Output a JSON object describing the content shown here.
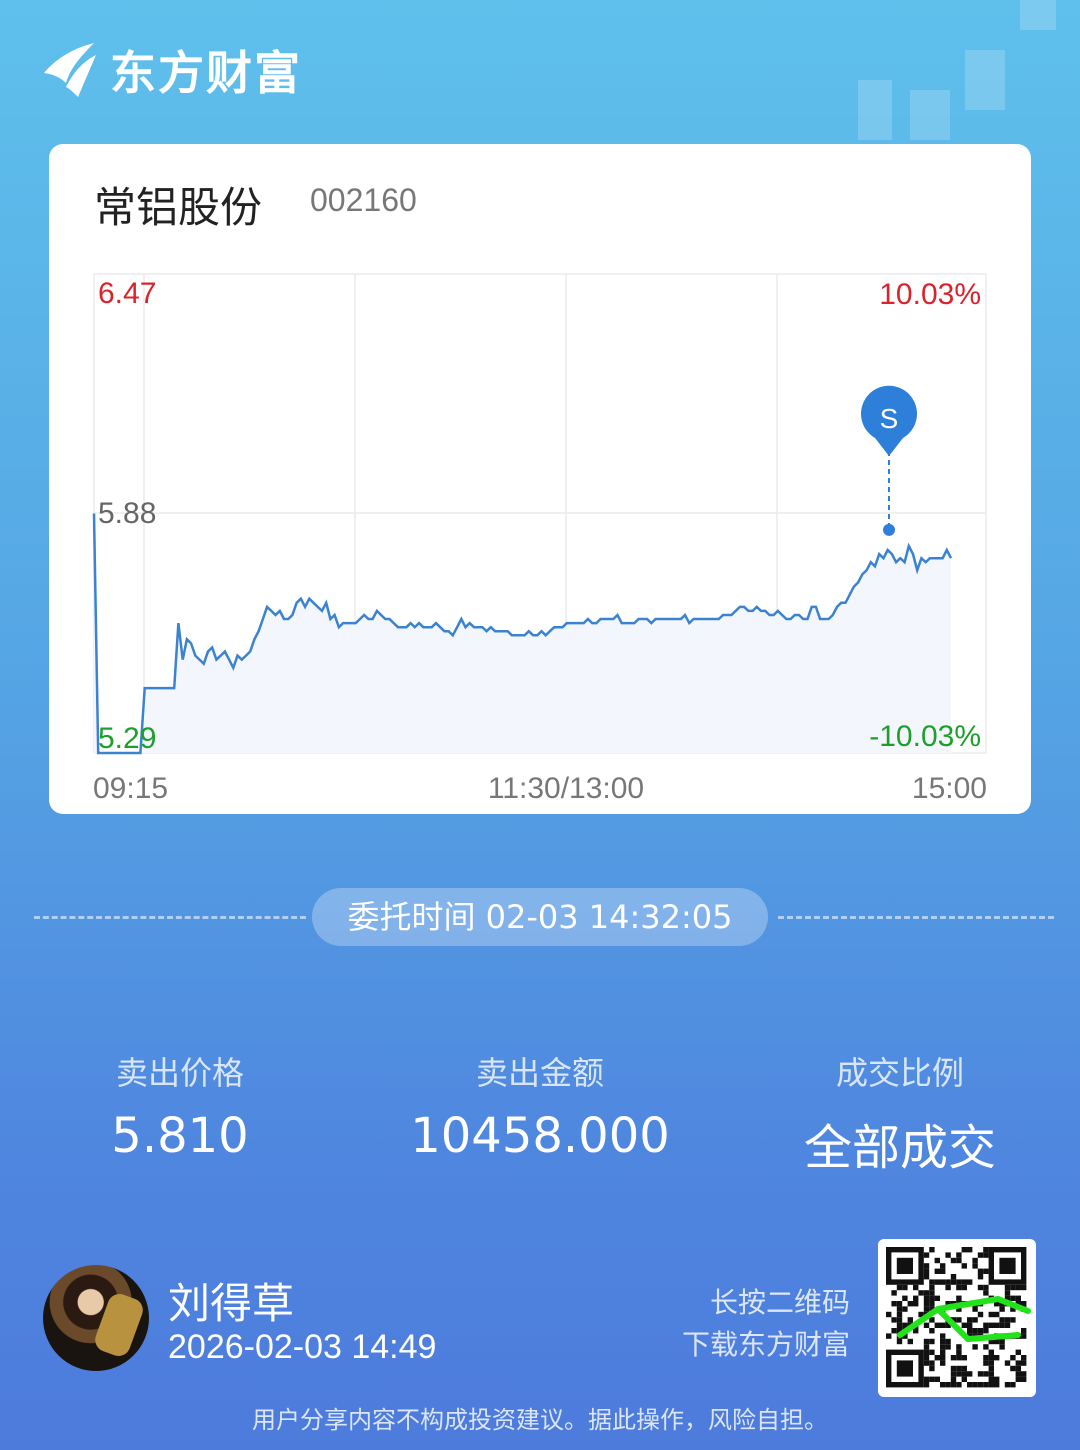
{
  "brand": {
    "name": "东方财富",
    "logo_icon": "eastmoney-logo-icon"
  },
  "stock": {
    "name": "常铝股份",
    "code": "002160"
  },
  "chart_data": {
    "type": "line",
    "series": [
      {
        "values": [
          5.88,
          5.29,
          5.29,
          5.29,
          5.29,
          5.29,
          5.29,
          5.29,
          5.29,
          5.29,
          5.29,
          5.29,
          5.45,
          5.45,
          5.45,
          5.45,
          5.45,
          5.45,
          5.45,
          5.45,
          5.61,
          5.52,
          5.57,
          5.56,
          5.53,
          5.52,
          5.51,
          5.54,
          5.55,
          5.52,
          5.53,
          5.54,
          5.52,
          5.5,
          5.53,
          5.52,
          5.53,
          5.54,
          5.57,
          5.59,
          5.62,
          5.65,
          5.64,
          5.63,
          5.64,
          5.62,
          5.62,
          5.63,
          5.66,
          5.67,
          5.65,
          5.67,
          5.66,
          5.65,
          5.64,
          5.66,
          5.62,
          5.63,
          5.6,
          5.61,
          5.61,
          5.61,
          5.61,
          5.62,
          5.63,
          5.62,
          5.62,
          5.64,
          5.63,
          5.62,
          5.62,
          5.61,
          5.6,
          5.6,
          5.6,
          5.61,
          5.6,
          5.61,
          5.6,
          5.6,
          5.6,
          5.61,
          5.6,
          5.59,
          5.59,
          5.58,
          5.6,
          5.62,
          5.6,
          5.61,
          5.6,
          5.6,
          5.6,
          5.59,
          5.6,
          5.59,
          5.59,
          5.59,
          5.59,
          5.58,
          5.58,
          5.58,
          5.58,
          5.59,
          5.58,
          5.58,
          5.59,
          5.58,
          5.59,
          5.6,
          5.6,
          5.6,
          5.61,
          5.61,
          5.61,
          5.61,
          5.61,
          5.62,
          5.61,
          5.61,
          5.62,
          5.62,
          5.62,
          5.62,
          5.63,
          5.61,
          5.61,
          5.61,
          5.61,
          5.62,
          5.62,
          5.62,
          5.61,
          5.62,
          5.62,
          5.62,
          5.62,
          5.62,
          5.62,
          5.62,
          5.63,
          5.61,
          5.62,
          5.62,
          5.62,
          5.62,
          5.62,
          5.62,
          5.62,
          5.63,
          5.63,
          5.63,
          5.64,
          5.65,
          5.65,
          5.64,
          5.64,
          5.65,
          5.64,
          5.64,
          5.63,
          5.63,
          5.64,
          5.63,
          5.62,
          5.62,
          5.63,
          5.63,
          5.62,
          5.62,
          5.65,
          5.65,
          5.62,
          5.62,
          5.62,
          5.63,
          5.65,
          5.66,
          5.66,
          5.68,
          5.7,
          5.71,
          5.73,
          5.74,
          5.76,
          5.75,
          5.78,
          5.77,
          5.79,
          5.78,
          5.76,
          5.77,
          5.76,
          5.8,
          5.78,
          5.74,
          5.77,
          5.76,
          5.77,
          5.77,
          5.77,
          5.77,
          5.79,
          5.77
        ]
      }
    ],
    "xticks": [
      "09:15",
      "11:30/13:00",
      "15:00"
    ],
    "y_left": {
      "top": "6.47",
      "mid": "5.88",
      "bottom": "5.29"
    },
    "y_right": {
      "top": "10.03%",
      "bottom": "-10.03%"
    },
    "ylim": [
      5.29,
      6.47
    ],
    "marker": {
      "label": "S",
      "value": 5.81
    },
    "colors": {
      "line": "#3b82d0",
      "up": "#d9232d",
      "down": "#1d9f2a",
      "fill": "#f3f7fd",
      "marker": "#2e7fd9"
    }
  },
  "order": {
    "time_label": "委托时间 02-03 14:32:05"
  },
  "stats": [
    {
      "label": "卖出价格",
      "value": "5.810"
    },
    {
      "label": "卖出金额",
      "value": "10458.000"
    },
    {
      "label": "成交比例",
      "value": "全部成交"
    }
  ],
  "user": {
    "name": "刘得草",
    "time": "2026-02-03 14:49"
  },
  "qr": {
    "hint_line1": "长按二维码",
    "hint_line2": "下载东方财富"
  },
  "disclaimer": "用户分享内容不构成投资建议。据此操作，风险自担。"
}
